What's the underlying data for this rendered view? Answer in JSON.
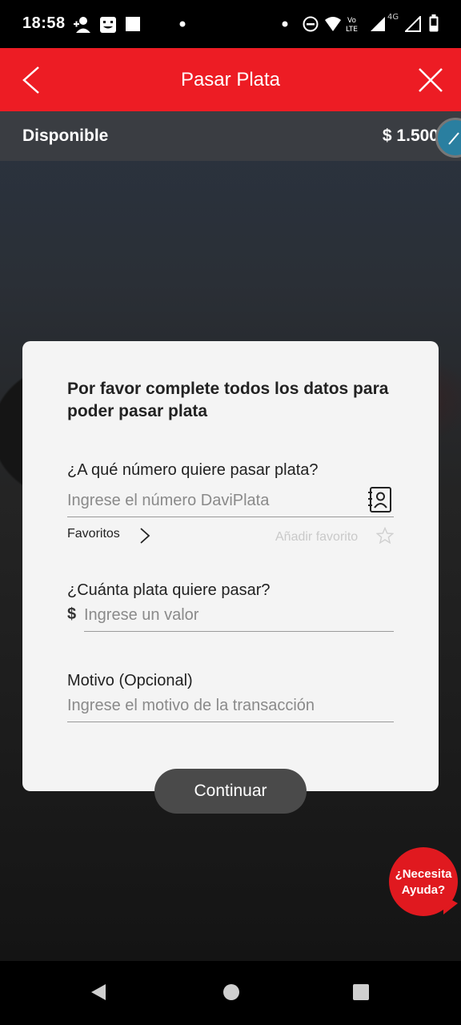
{
  "status_bar": {
    "time": "18:58"
  },
  "app_bar": {
    "title": "Pasar Plata"
  },
  "balance": {
    "label": "Disponible",
    "amount": "$ 1.500"
  },
  "form": {
    "title": "Por favor complete todos los datos para poder pasar plata",
    "number_label": "¿A qué número quiere pasar plata?",
    "number_placeholder": "Ingrese el número DaviPlata",
    "favorites_label": "Favoritos",
    "add_favorite_label": "Añadir favorito",
    "amount_label": "¿Cuánta plata quiere pasar?",
    "currency_symbol": "$",
    "amount_placeholder": "Ingrese un valor",
    "reason_label": "Motivo (Opcional)",
    "reason_placeholder": "Ingrese el motivo de la transacción",
    "continue_label": "Continuar"
  },
  "help": {
    "label": "¿Necesita Ayuda?"
  },
  "colors": {
    "brand_red": "#ed1c24",
    "card_bg": "#f4f4f4",
    "button_dark": "#4a4a4a"
  }
}
